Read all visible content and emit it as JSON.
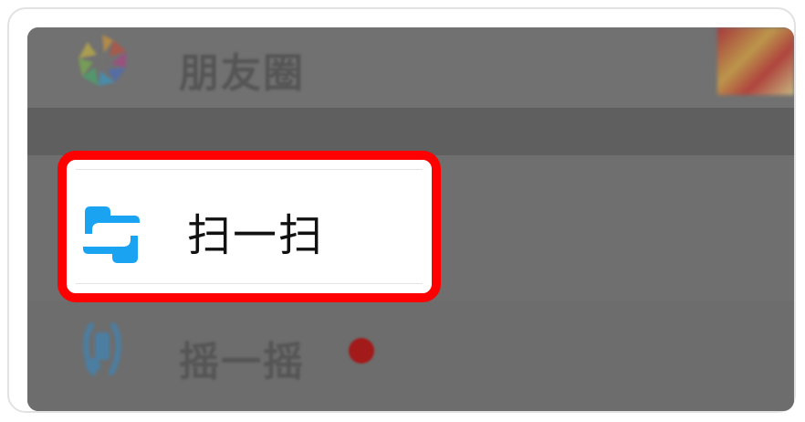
{
  "menu": {
    "moments_label": "朋友圈",
    "scan_label": "扫一扫",
    "shake_label": "摇一摇"
  },
  "icons": {
    "moments": "moments-aperture-icon",
    "scan": "scan-icon",
    "shake": "shake-phone-icon",
    "thumbnail": "moments-thumbnail"
  },
  "colors": {
    "highlight": "#ff0000",
    "scan_icon": "#1aa3f0",
    "notification_dot": "#a31a1a",
    "overlay": "#6e6e6e"
  }
}
